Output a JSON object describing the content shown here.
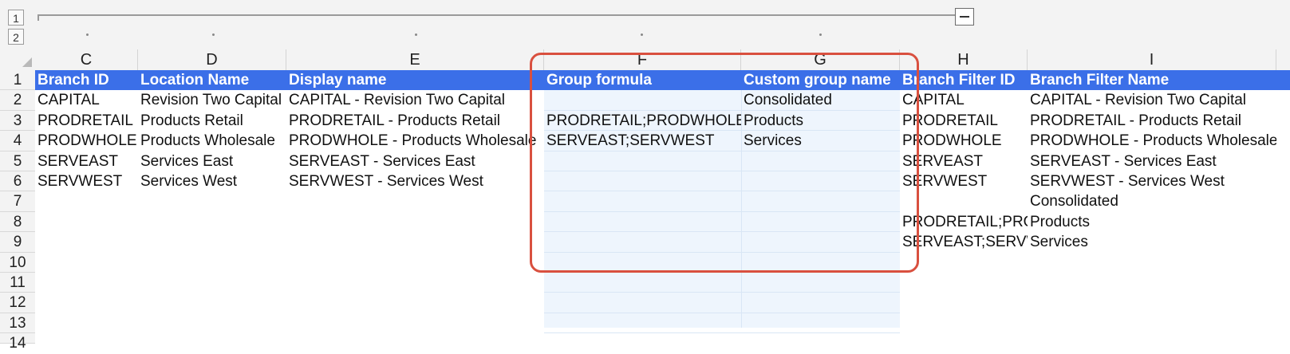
{
  "outline": {
    "level_1": "1",
    "level_2": "2"
  },
  "columns": [
    "C",
    "D",
    "E",
    "F",
    "G",
    "H",
    "I"
  ],
  "rows": [
    "1",
    "2",
    "3",
    "4",
    "5",
    "6",
    "7",
    "8",
    "9",
    "10",
    "11",
    "12",
    "13",
    "14"
  ],
  "header": {
    "C": "Branch ID",
    "D": "Location Name",
    "E": "Display name",
    "F": "Group formula",
    "G": "Custom group name",
    "H": "Branch Filter ID",
    "I": "Branch Filter Name"
  },
  "data": {
    "C": [
      "CAPITAL",
      "PRODRETAIL",
      "PRODWHOLE",
      "SERVEAST",
      "SERVWEST"
    ],
    "D": [
      "Revision Two Capital",
      "Products Retail",
      "Products Wholesale",
      "Services East",
      "Services West"
    ],
    "E": [
      "CAPITAL - Revision Two Capital",
      "PRODRETAIL - Products Retail",
      "PRODWHOLE - Products Wholesale",
      "SERVEAST - Services East",
      "SERVWEST - Services West"
    ],
    "F": [
      "",
      "PRODRETAIL;PRODWHOLE",
      "SERVEAST;SERVWEST"
    ],
    "G": [
      "Consolidated",
      "Products",
      "Services"
    ],
    "H": [
      "CAPITAL",
      "PRODRETAIL",
      "PRODWHOLE",
      "SERVEAST",
      "SERVWEST",
      "",
      "PRODRETAIL;PRO",
      "SERVEAST;SERVW"
    ],
    "I": [
      "CAPITAL - Revision Two Capital",
      "PRODRETAIL - Products Retail",
      "PRODWHOLE - Products Wholesale",
      "SERVEAST - Services East",
      "SERVWEST - Services West",
      "Consolidated",
      "Products",
      "Services"
    ]
  },
  "colors": {
    "header_fill": "#3b6fe8",
    "highlight_border": "#d9503f",
    "selection_fill": "#eef5fd"
  },
  "icons": {
    "collapse": "minus-box-icon"
  }
}
